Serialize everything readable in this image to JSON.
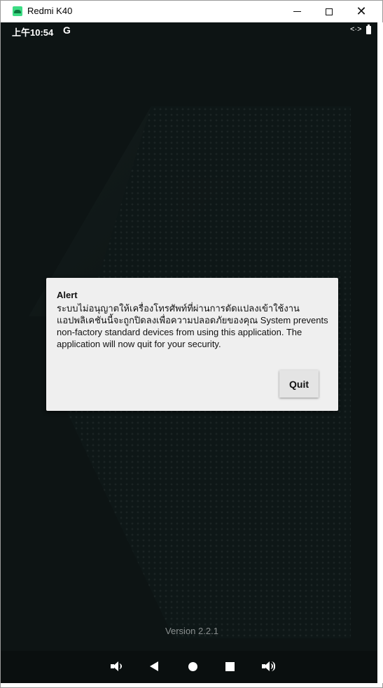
{
  "window": {
    "title": "Redmi K40",
    "minimize": "",
    "maximize": "",
    "close": "✕"
  },
  "statusbar": {
    "time": "上午10:54",
    "g_icon": "G",
    "data_icon": "<·>",
    "icons": [
      "google-icon",
      "data-transfer-icon",
      "battery-icon"
    ]
  },
  "dialog": {
    "title": "Alert",
    "message": "ระบบไม่อนุญาตให้เครื่องโทรศัพท์ที่ผ่านการดัดแปลงเข้าใช้งานแอปพลิเคชันนี้จะถูกปิดลงเพื่อความปลอดภัยของคุณ System prevents non-factory standard devices from using this application. The application will now quit for your security.",
    "quit_label": "Quit"
  },
  "footer": {
    "version": "Version 2.2.1"
  },
  "navbar": {
    "items": [
      "volume-down-icon",
      "back-icon",
      "home-icon",
      "recents-icon",
      "volume-up-icon"
    ]
  },
  "colors": {
    "background": "#0d1414",
    "dialog_bg": "#efefef",
    "version_text": "#8a8f8f"
  }
}
